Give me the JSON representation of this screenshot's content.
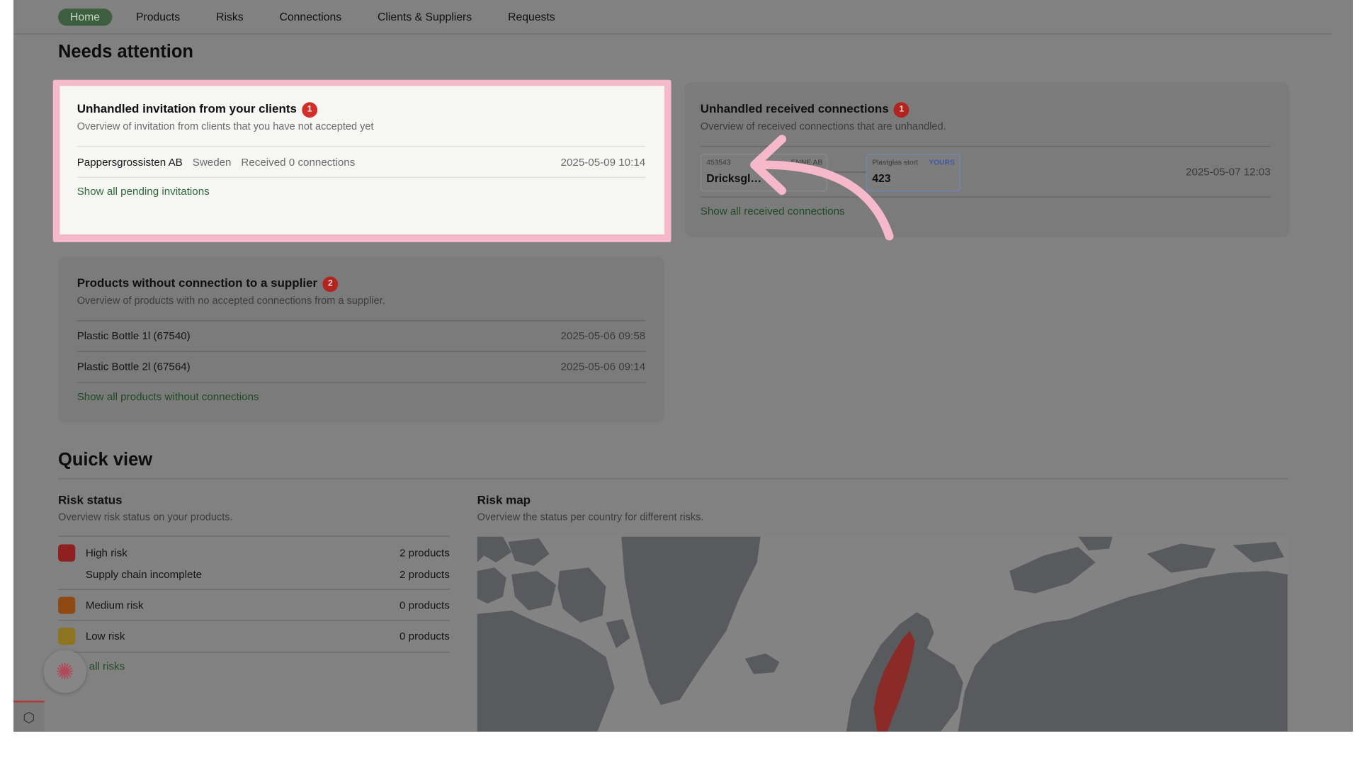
{
  "nav": {
    "items": [
      "Home",
      "Products",
      "Risks",
      "Connections",
      "Clients & Suppliers",
      "Requests"
    ],
    "active": "Home"
  },
  "needs_attention": {
    "title": "Needs attention",
    "invitations": {
      "title": "Unhandled invitation from your clients",
      "badge": "1",
      "subtitle": "Overview of invitation from clients that you have not accepted yet",
      "row": {
        "name": "Pappersgrossisten AB",
        "country": "Sweden",
        "status": "Received 0 connections",
        "date": "2025-05-09 10:14"
      },
      "link": "Show all pending invitations"
    },
    "received": {
      "title": "Unhandled received connections",
      "badge": "1",
      "subtitle": "Overview of received connections that are unhandled.",
      "row": {
        "left_id": "453543",
        "left_company": "…ENNE AB",
        "left_value": "Dricksgl…",
        "right_label": "Plastglas stort",
        "right_tag": "YOURS",
        "right_value": "423",
        "date": "2025-05-07 12:03"
      },
      "link": "Show all received connections"
    },
    "products": {
      "title": "Products without connection to a supplier",
      "badge": "2",
      "subtitle": "Overview of products with no accepted connections from a supplier.",
      "rows": [
        {
          "name": "Plastic Bottle 1l (67540)",
          "date": "2025-05-06 09:58"
        },
        {
          "name": "Plastic Bottle 2l (67564)",
          "date": "2025-05-06 09:14"
        }
      ],
      "link": "Show all products without connections"
    }
  },
  "quick_view": {
    "title": "Quick view",
    "risk_status": {
      "title": "Risk status",
      "subtitle": "Overview risk status on your products.",
      "items": [
        {
          "label": "High risk",
          "count": "2 products",
          "color": "#8e2020"
        },
        {
          "label": "Supply chain incomplete",
          "count": "2 products"
        },
        {
          "label": "Medium risk",
          "count": "0 products",
          "color": "#8f4a14"
        },
        {
          "label": "Low risk",
          "count": "0 products",
          "color": "#8d7420"
        }
      ],
      "link": "all risks"
    },
    "risk_map": {
      "title": "Risk map",
      "subtitle": "Overview the status per country for different risks.",
      "land_color": "#585a5e",
      "highlight_color": "#8b2b27"
    }
  },
  "colors": {
    "accent_pink": "#f6b9cb",
    "badge_red": "#d32f2a",
    "link_green": "#2f6b37"
  }
}
